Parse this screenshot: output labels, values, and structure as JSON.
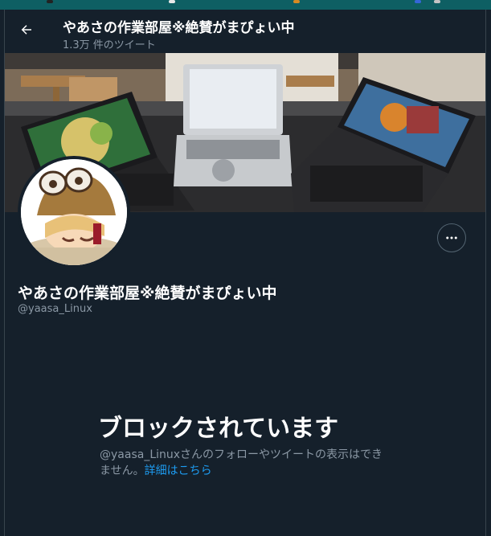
{
  "header": {
    "title": "やあさの作業部屋※絶賛がまぴょい中",
    "tweet_count": "1.3万 件のツイート"
  },
  "profile": {
    "name": "やあさの作業部屋※絶賛がまぴょい中",
    "handle": "@yaasa_Linux"
  },
  "blocked": {
    "title": "ブロックされています",
    "message": "@yaasa_Linuxさんのフォローやツイートの表示はできません。",
    "link_label": "詳細はこちら"
  },
  "icons": {
    "back": "arrow-left-icon",
    "more": "more-horizontal-icon"
  },
  "colors": {
    "background": "#15202b",
    "accent": "#1d9bf0",
    "secondary_text": "#8b98a5"
  }
}
